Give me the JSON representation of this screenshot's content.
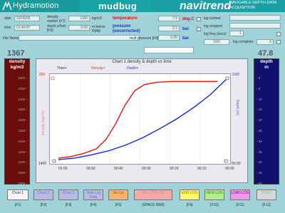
{
  "header": {
    "hydra_logo": "hydramotion-logo",
    "hydra_name": "Hydramotion",
    "app_name": "mudbug",
    "brand": "navitrend",
    "brand_sub": "NAVIGABLE DEPTH DATA ACQUISITION"
  },
  "info": {
    "date_label": "date",
    "date_value": "23/05/05",
    "time_label": "time",
    "time_value": "01:40:07",
    "file_label": "File Name",
    "file_value": ""
  },
  "markers": {
    "density_marker_label": "density marker [F7]",
    "density_marker_value": "1100",
    "density_marker_unit": "kg/m3",
    "depth_offset_label": "depth o/fset [F6]",
    "depth_offset_value": "0.00",
    "depth_offset_unit": "m below RMM"
  },
  "readings": {
    "temp_label": "temperature",
    "temp_value": "7.5",
    "temp_unit": "deg.C",
    "pressure_label": "pressure (uncorrected)",
    "pressure_value": "2.1",
    "pressure_unit": "bar",
    "mult_label": "mult pressure [F8]",
    "mult_value": "0.00",
    "mult_unit": "bar"
  },
  "log": {
    "started_label": "log started",
    "stopped_label": "log stopped",
    "freq_label": "log freq (secs)",
    "freq_value": "1",
    "freq_select": "10/2",
    "complete_label": "log complete",
    "complete_value": "0"
  },
  "density_gauge": {
    "value": "1367",
    "title1": "density",
    "title2": "kg/m3",
    "ticks": [
      "1500",
      "1450",
      "1400",
      "1350",
      "1300",
      "1250",
      "1200",
      "1150",
      "1100",
      "1050",
      "1000"
    ],
    "color": "#6b0d0d"
  },
  "depth_gauge": {
    "value": "47.8",
    "title1": "depth",
    "title2": "m",
    "ticks": [
      "0",
      "5",
      "10",
      "15",
      "20",
      "25",
      "30",
      "35",
      "40",
      "45",
      "50"
    ],
    "color": "#11106e"
  },
  "chart_data": {
    "type": "line",
    "title": "Chart 1  density & depth vs time",
    "legend": [
      "Time+",
      "Density+",
      "Depth+"
    ],
    "ylabel_left": "Density (kg/m3)",
    "ylabel_right": "Depth (m)",
    "y_left_top": "880",
    "y_left_bottom": "1400",
    "y_right_top": "0.00",
    "y_right_bottom": "50.00",
    "x_ticks": [
      "01:00",
      "00:50",
      "00:40",
      "00:30",
      "00:20",
      "00:10",
      "00:00"
    ],
    "series": [
      {
        "color": "#ee1111",
        "values": [
          [
            0,
            1390
          ],
          [
            0.08,
            1380
          ],
          [
            0.16,
            1360
          ],
          [
            0.24,
            1330
          ],
          [
            0.3,
            1270
          ],
          [
            0.36,
            1170
          ],
          [
            0.42,
            1050
          ],
          [
            0.48,
            960
          ],
          [
            0.54,
            920
          ],
          [
            0.62,
            905
          ],
          [
            0.72,
            900
          ],
          [
            0.85,
            900
          ],
          [
            1,
            900
          ]
        ]
      },
      {
        "color": "#1122ee",
        "values": [
          [
            0,
            50
          ],
          [
            0.1,
            49
          ],
          [
            0.2,
            47
          ],
          [
            0.3,
            44.5
          ],
          [
            0.4,
            41
          ],
          [
            0.5,
            36.5
          ],
          [
            0.6,
            31
          ],
          [
            0.7,
            25
          ],
          [
            0.8,
            18
          ],
          [
            0.9,
            10
          ],
          [
            0.97,
            3
          ],
          [
            1,
            0
          ]
        ]
      }
    ]
  },
  "fkeys": [
    {
      "label": "Chart 1",
      "key": "[F1]",
      "bg": "#f4f4f4",
      "fg": "#333"
    },
    {
      "label": "Chart 2",
      "key": "[F2]",
      "bg": "#b7b9e7",
      "fg": "#7777aa"
    },
    {
      "label": "Chart 3",
      "key": "[F3]",
      "bg": "#b7b9e7",
      "fg": "#7777aa"
    },
    {
      "label": "View Log Data",
      "key": "[F4]",
      "bg": "#b7b9e7",
      "fg": "#7777aa"
    },
    {
      "label": "Set Up",
      "key": "[F5]",
      "bg": "#f2b56b",
      "fg": "#aa5500"
    },
    {
      "label": "REC / PAUSE",
      "key": "[SPACE BAR]",
      "bg": "#f4a9a9",
      "fg": "#dd8888"
    },
    {
      "label": "END LOG",
      "key": "[F9]",
      "bg": "#fffa66",
      "fg": "#aa7700"
    },
    {
      "label": "NEW LOG",
      "key": "[F10]",
      "bg": "#b0ee88",
      "fg": "#338800"
    },
    {
      "label": "LOAD LOG",
      "key": "[F11]",
      "bg": "#ee99ee",
      "fg": "#880088"
    },
    {
      "label": "PRINT",
      "key": "[F12]",
      "bg": "#d8d8d8",
      "fg": "#aaaaaa"
    }
  ]
}
